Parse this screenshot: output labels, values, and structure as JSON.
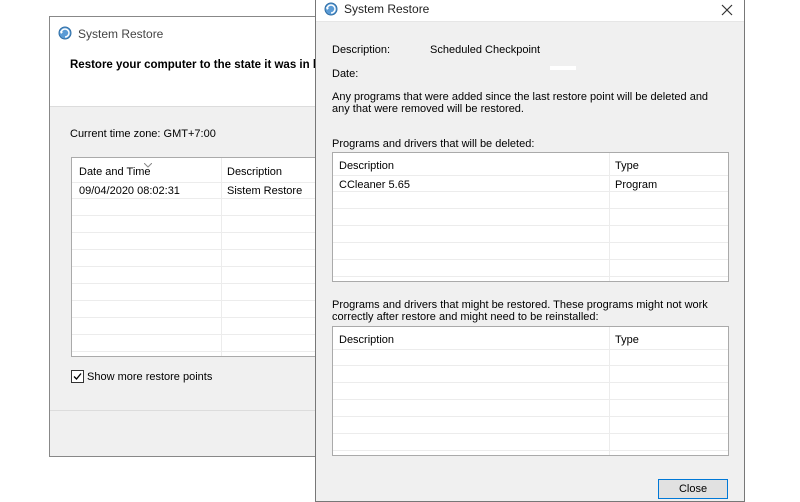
{
  "back_window": {
    "title": "System Restore",
    "heading": "Restore your computer to the state it was in b",
    "timezone": "Current time zone: GMT+7:00",
    "columns": {
      "date": "Date and Time",
      "description": "Description"
    },
    "rows": [
      {
        "date": "09/04/2020 08:02:31",
        "description": "Sistem Restore"
      }
    ],
    "show_more_label": "Show more restore points",
    "show_more_checked": true
  },
  "front_window": {
    "title": "System Restore",
    "description_label": "Description:",
    "description_value": "Scheduled Checkpoint",
    "date_label": "Date:",
    "info_text": "Any programs that were added since the last restore point will be deleted and any that were removed will be restored.",
    "deleted_section": {
      "label": "Programs and drivers that will be deleted:",
      "columns": {
        "description": "Description",
        "type": "Type"
      },
      "rows": [
        {
          "description": "CCleaner 5.65",
          "type": "Program"
        }
      ]
    },
    "restored_section": {
      "label": "Programs and drivers that might be restored. These programs might not work correctly after restore and might need to be reinstalled:",
      "columns": {
        "description": "Description",
        "type": "Type"
      },
      "rows": []
    },
    "close_button": "Close"
  },
  "colors": {
    "window_bg": "#f0f0f0",
    "button_border": "#0078d7",
    "list_border": "#aaaaaa"
  }
}
